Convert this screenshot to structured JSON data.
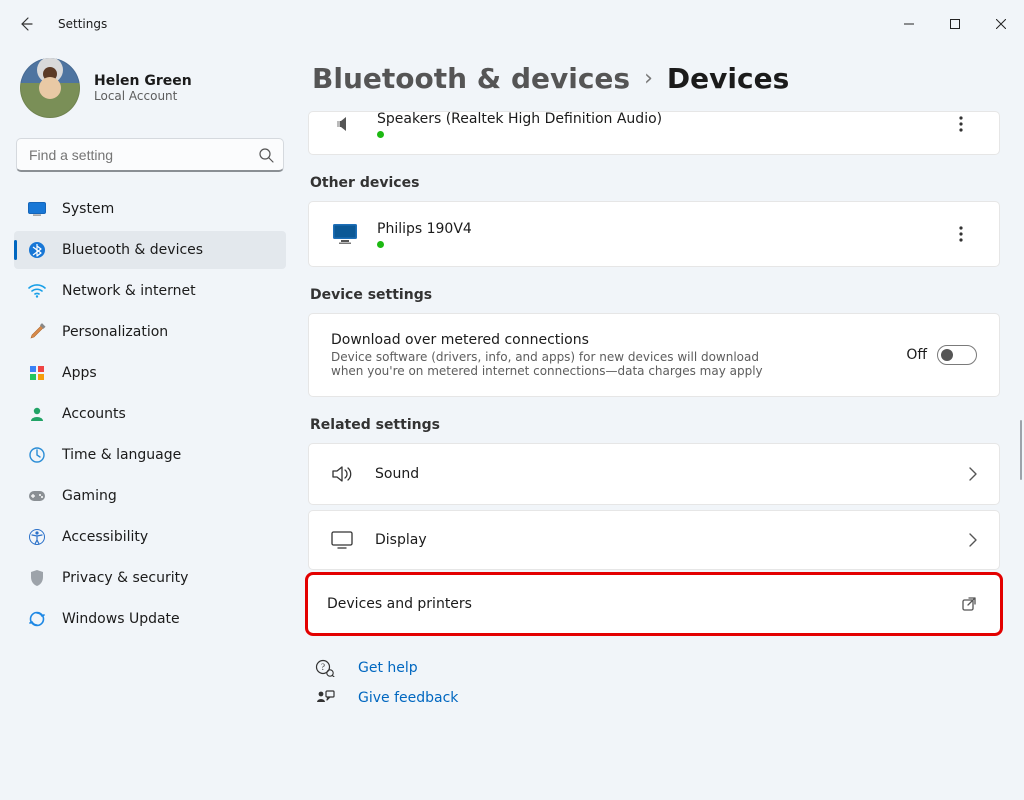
{
  "window": {
    "title": "Settings"
  },
  "user": {
    "name": "Helen Green",
    "type": "Local Account"
  },
  "search": {
    "placeholder": "Find a setting"
  },
  "nav": {
    "items": [
      {
        "id": "system",
        "label": "System"
      },
      {
        "id": "bluetooth",
        "label": "Bluetooth & devices"
      },
      {
        "id": "network",
        "label": "Network & internet"
      },
      {
        "id": "personalization",
        "label": "Personalization"
      },
      {
        "id": "apps",
        "label": "Apps"
      },
      {
        "id": "accounts",
        "label": "Accounts"
      },
      {
        "id": "time",
        "label": "Time & language"
      },
      {
        "id": "gaming",
        "label": "Gaming"
      },
      {
        "id": "accessibility",
        "label": "Accessibility"
      },
      {
        "id": "privacy",
        "label": "Privacy & security"
      },
      {
        "id": "update",
        "label": "Windows Update"
      }
    ],
    "active": "bluetooth"
  },
  "breadcrumb": {
    "parent": "Bluetooth & devices",
    "current": "Devices"
  },
  "devices_audio": {
    "items": [
      {
        "name": "Speakers (Realtek High Definition Audio)",
        "online": true
      }
    ]
  },
  "other_devices": {
    "label": "Other devices",
    "items": [
      {
        "name": "Philips 190V4",
        "online": true
      }
    ]
  },
  "device_settings": {
    "label": "Device settings",
    "metered": {
      "title": "Download over metered connections",
      "desc": "Device software (drivers, info, and apps) for new devices will download when you're on metered internet connections—data charges may apply",
      "state_label": "Off",
      "on": false
    }
  },
  "related_settings": {
    "label": "Related settings",
    "items": [
      {
        "id": "sound",
        "label": "Sound",
        "action": "navigate"
      },
      {
        "id": "display",
        "label": "Display",
        "action": "navigate"
      },
      {
        "id": "dnp",
        "label": "Devices and printers",
        "action": "external",
        "highlighted": true
      }
    ]
  },
  "footer": {
    "help": "Get help",
    "feedback": "Give feedback"
  }
}
